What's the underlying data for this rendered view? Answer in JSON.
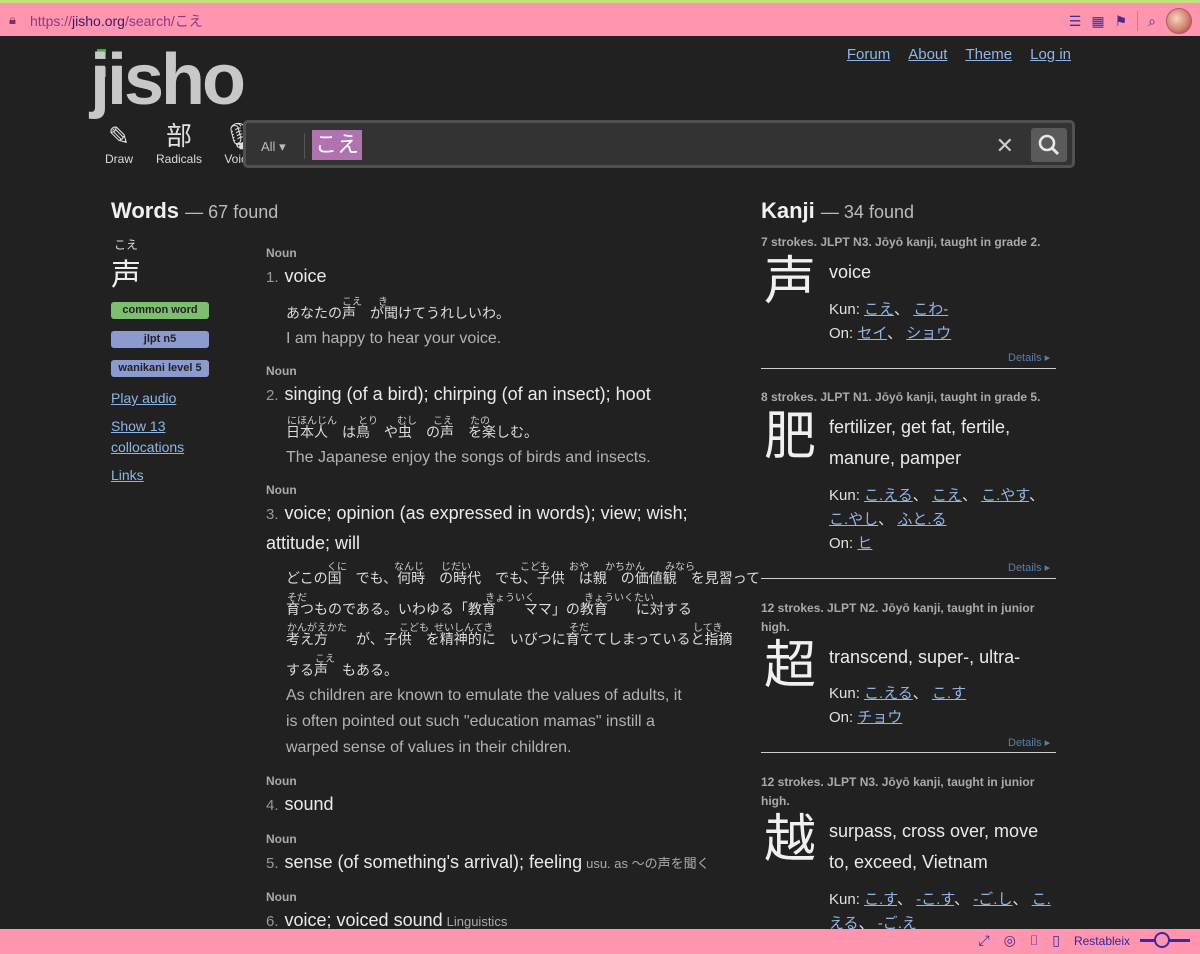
{
  "browser": {
    "url_prefix": "https://",
    "url_host": "jisho.org",
    "url_path": "/search/こえ",
    "bottom_label": "Restableix"
  },
  "header": {
    "logo": "jisho",
    "nav": [
      "Forum",
      "About",
      "Theme",
      "Log in"
    ],
    "tools": [
      {
        "label": "Draw",
        "glyph": "✎"
      },
      {
        "label": "Radicals",
        "glyph": "部"
      },
      {
        "label": "Voice",
        "glyph": "🎙"
      }
    ]
  },
  "search": {
    "scope": "All",
    "value": "こえ"
  },
  "words": {
    "title": "Words",
    "count": "— 67 found",
    "furigana": "こえ",
    "kanji": "声",
    "tags": [
      "common word",
      "jlpt n5",
      "wanikani level 5"
    ],
    "links": [
      "Play audio",
      "Show 13 collocations",
      "Links"
    ],
    "senses": [
      {
        "pos": "Noun",
        "num": "1.",
        "meaning": "voice"
      },
      {
        "pos": "Noun",
        "num": "2.",
        "meaning": "singing (of a bird); chirping (of an insect); hoot"
      },
      {
        "pos": "Noun",
        "num": "3.",
        "meaning": "voice; opinion (as expressed in words); view; wish;",
        "meaning_cont": "attitude; will"
      },
      {
        "pos": "Noun",
        "num": "4.",
        "meaning": "sound"
      },
      {
        "pos": "Noun",
        "num": "5.",
        "meaning": "sense (of something's arrival); feeling",
        "note": "usu. as ～の声を聞く"
      },
      {
        "pos": "Noun",
        "num": "6.",
        "meaning": "voice; voiced sound",
        "note": "Linguistics"
      }
    ],
    "examples": {
      "s1_ja": "あなたの声　が聞けてうれしいわ。",
      "s1_ruby": [
        "こえ",
        "き"
      ],
      "s1_en": "I am happy to hear your voice.",
      "s2_ja": "日本人　は鳥　や虫　の声　を楽しむ。",
      "s2_ruby": [
        "にほんじん",
        "とり",
        "むし",
        "こえ",
        "たの"
      ],
      "s2_en": "The Japanese enjoy the songs of birds and insects.",
      "s3_ja": [
        "どこの国　でも、何時　の時代　でも、子供　は親　の価値観　を見習って",
        "育つものである。いわゆる「教育　　ママ」の教育　　に対する",
        "考え方　　が、子供　を精神的に　いびつに育ててしまっていると指摘",
        "する声　もある。"
      ],
      "s3_ruby": [
        [
          "くに",
          "なんじ",
          "じだい",
          "こども",
          "おや",
          "かちかん",
          "みなら"
        ],
        [
          "そだ",
          "きょういく",
          "きょういくたい"
        ],
        [
          "かんがえかた",
          "こども",
          "せいしんてき",
          "そだ",
          "してき"
        ],
        [
          "こえ"
        ]
      ],
      "s3_en": [
        "As children are known to emulate the values of adults, it",
        "is often pointed out such \"education mamas\" instill a",
        "warped sense of values in their children."
      ]
    }
  },
  "kanji": {
    "title": "Kanji",
    "count": "— 34 found",
    "details": "Details ▸",
    "entries": [
      {
        "meta": "7 strokes. JLPT N3. Jōyō kanji, taught in grade 2.",
        "char": "声",
        "meaning": "voice",
        "kun_label": "Kun:",
        "kun": [
          "こえ",
          "こわ-"
        ],
        "on_label": "On:",
        "on": [
          "セイ",
          "ショウ"
        ]
      },
      {
        "meta": "8 strokes. JLPT N1. Jōyō kanji, taught in grade 5.",
        "char": "肥",
        "meaning": "fertilizer, get fat, fertile, manure, pamper",
        "kun_label": "Kun:",
        "kun": [
          "こ.える",
          "こえ",
          "こ.やす",
          "こ.やし",
          "ふと.る"
        ],
        "on_label": "On:",
        "on": [
          "ヒ"
        ]
      },
      {
        "meta": "12 strokes. JLPT N2. Jōyō kanji, taught in junior high.",
        "char": "超",
        "meaning": "transcend, super-, ultra-",
        "kun_label": "Kun:",
        "kun": [
          "こ.える",
          "こ.す"
        ],
        "on_label": "On:",
        "on": [
          "チョウ"
        ]
      },
      {
        "meta": "12 strokes. JLPT N3. Jōyō kanji, taught in junior high.",
        "char": "越",
        "meaning": "surpass, cross over, move to, exceed, Vietnam",
        "kun_label": "Kun:",
        "kun": [
          "こ.す",
          "-こ.す",
          "-ご.し",
          "こ.える",
          "-ご.え"
        ]
      }
    ]
  }
}
